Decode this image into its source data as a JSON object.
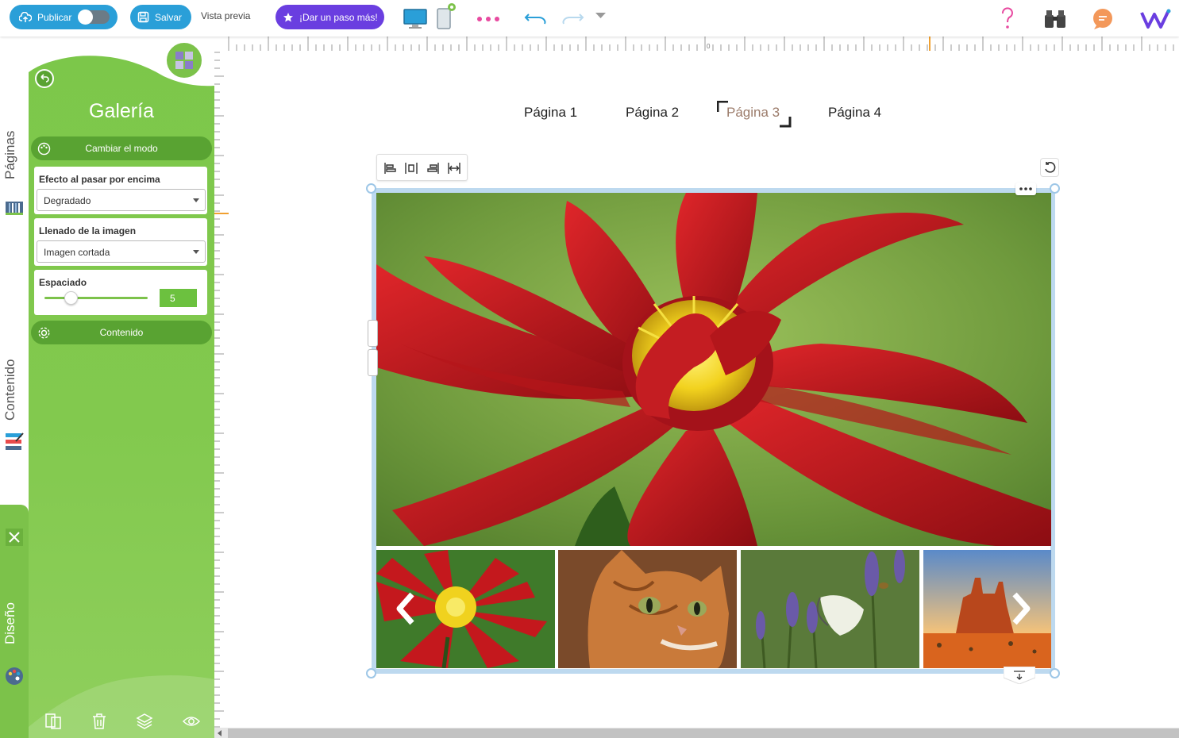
{
  "toolbar": {
    "publish_label": "Publicar",
    "save_label": "Salvar",
    "preview_label": "Vista previa",
    "upgrade_label": "¡Dar un paso más!",
    "icons": [
      "upload-cloud-icon",
      "save-disk-icon",
      "star-icon",
      "desktop-icon",
      "mobile-icon",
      "more-dots-icon",
      "undo-icon",
      "redo-icon",
      "history-dropdown-icon",
      "help-question-icon",
      "binoculars-icon",
      "chat-bubble-icon",
      "w-logo-icon"
    ]
  },
  "sidebar": {
    "tab_pages": "Páginas",
    "tab_content": "Contenido",
    "tab_design": "Diseño"
  },
  "panel": {
    "title": "Galería",
    "change_mode_label": "Cambiar el modo",
    "hover_effect_label": "Efecto al pasar por encima",
    "hover_effect_value": "Degradado",
    "image_fill_label": "Llenado de la imagen",
    "image_fill_value": "Imagen cortada",
    "spacing_label": "Espaciado",
    "spacing_value": "5",
    "spacing_fraction": 0.25,
    "content_label": "Contenido"
  },
  "ruler": {
    "zero_label": "0"
  },
  "page_menu": {
    "items": [
      "Página 1",
      "Página 2",
      "Página 3",
      "Página 4"
    ],
    "selected_index": 2
  },
  "gallery": {
    "main_image": "red-dahlia-flower",
    "thumbnails": [
      "red-dahlia-flower",
      "orange-tabby-cat",
      "butterfly-on-lavender",
      "desert-butte"
    ]
  },
  "colors": {
    "panel_green": "#7cc74a",
    "bar_green": "#59a332",
    "toolbar_blue": "#2a9fd8",
    "upgrade_purple": "#6a3ee0",
    "selection_blue": "#bdd9ef",
    "accent_pink": "#e84aa0"
  }
}
